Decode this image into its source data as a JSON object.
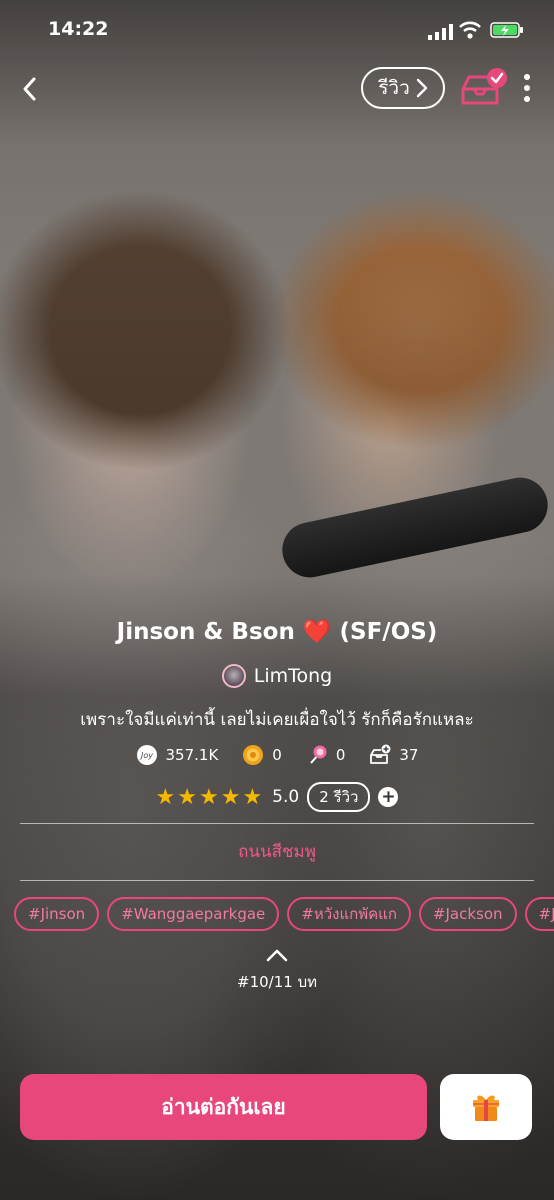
{
  "status_bar": {
    "time": "14:22"
  },
  "header": {
    "review_label": "รีวิว"
  },
  "story": {
    "title": "Jinson & Bson",
    "title_emoji": "❤️",
    "title_suffix": "(SF/OS)",
    "author": "LimTong",
    "description": "เพราะใจมีแค่เท่านี้ เลยไม่เคยเผื่อใจไว้ รักก็คือรักแหละ",
    "stats": {
      "joy": "357.1K",
      "coins": "0",
      "candy": "0",
      "shelf_adds": "37"
    },
    "rating": {
      "score": "5.0",
      "stars": 5,
      "reviews_label": "2 รีวิว"
    },
    "category": "ถนนสีชมพู",
    "tags": [
      "#Jinson",
      "#Wanggaeparkgae",
      "#หวังแกพัคแก",
      "#Jackson",
      "#Jin"
    ],
    "chapter": "#10/11 บท"
  },
  "actions": {
    "read_label": "อ่านต่อกันเลย"
  },
  "colors": {
    "accent": "#e8477c",
    "star": "#f5b800",
    "heart": "#e0283a"
  },
  "icons": [
    "back-chevron-icon",
    "bookshelf-check-icon",
    "more-vertical-icon",
    "joy-icon",
    "coin-icon",
    "candy-icon",
    "add-to-shelf-icon",
    "star-icon",
    "plus-icon",
    "chevron-up-icon",
    "gift-icon"
  ]
}
